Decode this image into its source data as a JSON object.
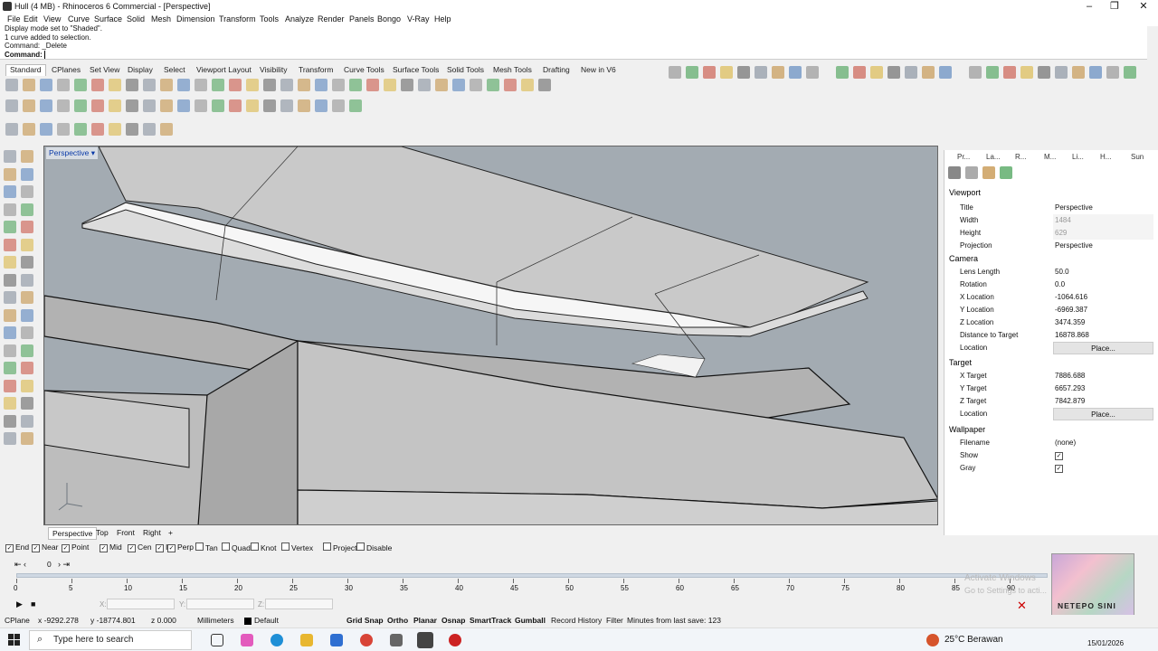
{
  "window": {
    "title": "Hull (4 MB) - Rhinoceros 6 Commercial - [Perspective]"
  },
  "menu": [
    "File",
    "Edit",
    "View",
    "Curve",
    "Surface",
    "Solid",
    "Mesh",
    "Dimension",
    "Transform",
    "Tools",
    "Analyze",
    "Render",
    "Panels",
    "Bongo",
    "V-Ray",
    "Help"
  ],
  "command": {
    "history": [
      "Display mode set to \"Shaded\".",
      "1 curve added to selection.",
      "Command: _Delete"
    ],
    "prompt": "Command:"
  },
  "toolbar_tabs": [
    "Standard",
    "CPlanes",
    "Set View",
    "Display",
    "Select",
    "Viewport Layout",
    "Visibility",
    "Transform",
    "Curve Tools",
    "Surface Tools",
    "Solid Tools",
    "Mesh Tools",
    "Drafting",
    "New in V6"
  ],
  "viewport": {
    "title": "Perspective"
  },
  "viewport_tabs": [
    "Perspective",
    "Top",
    "Front",
    "Right"
  ],
  "panel": {
    "tabs": [
      "Pr...",
      "La...",
      "R...",
      "M...",
      "Li...",
      "H...",
      "Sun"
    ],
    "viewport_section": "Viewport",
    "viewport_rows": [
      {
        "label": "Title",
        "value": "Perspective",
        "gray": false
      },
      {
        "label": "Width",
        "value": "1484",
        "gray": true
      },
      {
        "label": "Height",
        "value": "629",
        "gray": true
      },
      {
        "label": "Projection",
        "value": "Perspective",
        "gray": false
      }
    ],
    "camera_section": "Camera",
    "camera_rows": [
      {
        "label": "Lens Length",
        "value": "50.0"
      },
      {
        "label": "Rotation",
        "value": "0.0"
      },
      {
        "label": "X Location",
        "value": "-1064.616"
      },
      {
        "label": "Y Location",
        "value": "-6969.387"
      },
      {
        "label": "Z Location",
        "value": "3474.359"
      },
      {
        "label": "Distance to Target",
        "value": "16878.868"
      },
      {
        "label": "Location",
        "value": "Place..."
      }
    ],
    "target_section": "Target",
    "target_rows": [
      {
        "label": "X Target",
        "value": "7886.688"
      },
      {
        "label": "Y Target",
        "value": "6657.293"
      },
      {
        "label": "Z Target",
        "value": "7842.879"
      },
      {
        "label": "Location",
        "value": "Place..."
      }
    ],
    "wallpaper_section": "Wallpaper",
    "wallpaper_rows": [
      {
        "label": "Filename",
        "value": "(none)"
      },
      {
        "label": "Show",
        "value": ""
      },
      {
        "label": "Gray",
        "value": ""
      }
    ]
  },
  "osnap": [
    {
      "label": "End",
      "checked": true
    },
    {
      "label": "Near",
      "checked": true
    },
    {
      "label": "Point",
      "checked": true
    },
    {
      "label": "Mid",
      "checked": true
    },
    {
      "label": "Cen",
      "checked": true
    },
    {
      "label": "Int",
      "checked": true
    },
    {
      "label": "Perp",
      "checked": true
    },
    {
      "label": "Tan",
      "checked": false
    },
    {
      "label": "Quad",
      "checked": false
    },
    {
      "label": "Knot",
      "checked": false
    },
    {
      "label": "Vertex",
      "checked": false
    },
    {
      "label": "Project",
      "checked": false
    },
    {
      "label": "Disable",
      "checked": false
    }
  ],
  "timeline": {
    "frame": "0",
    "ticks": [
      "0",
      "5",
      "10",
      "15",
      "20",
      "25",
      "30",
      "35",
      "40",
      "45",
      "50",
      "55",
      "60",
      "65",
      "70",
      "75",
      "80",
      "85",
      "90"
    ],
    "x_label": "X:",
    "y_label": "Y:",
    "z_label": "Z:"
  },
  "status": {
    "cplane": "CPlane",
    "x": "x -9292.278",
    "y": "y -18774.801",
    "z": "z 0.000",
    "units": "Millimeters",
    "layer": "Default",
    "toggles": [
      "Grid Snap",
      "Ortho",
      "Planar",
      "Osnap",
      "SmartTrack",
      "Gumball",
      "Record History",
      "Filter"
    ],
    "save_info": "Minutes from last save: 123"
  },
  "taskbar": {
    "search_placeholder": "Type here to search",
    "weather": "25°C  Berawan",
    "date": "15/01/2026"
  },
  "watermark": {
    "text": "Activate Windows",
    "sub": "Go to Settings to acti..."
  },
  "overlay_text": "NETEPO SINI",
  "colors": {
    "accent": "#0a3aa8",
    "viewport_bg": "#a3abb2",
    "surface": "#c7c7c7"
  }
}
